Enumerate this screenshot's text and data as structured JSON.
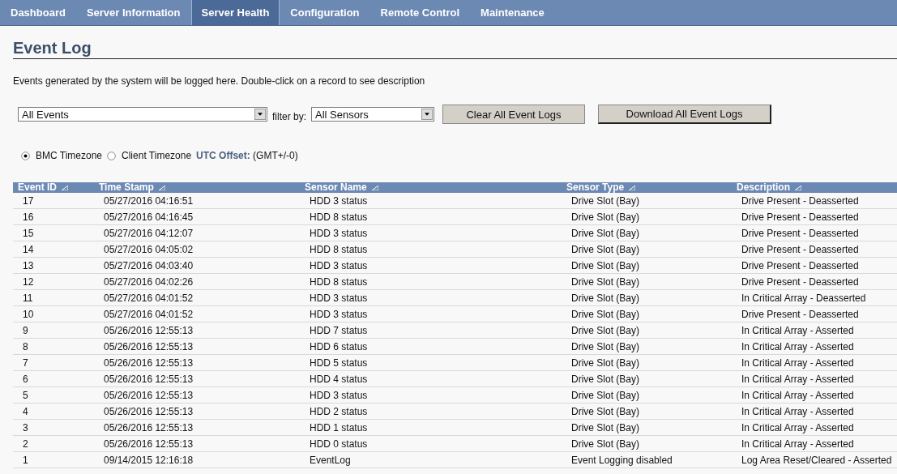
{
  "nav": [
    {
      "label": "Dashboard",
      "selected": false
    },
    {
      "label": "Server Information",
      "selected": false
    },
    {
      "label": "Server Health",
      "selected": true
    },
    {
      "label": "Configuration",
      "selected": false
    },
    {
      "label": "Remote Control",
      "selected": false
    },
    {
      "label": "Maintenance",
      "selected": false
    }
  ],
  "title": "Event Log",
  "description": "Events generated by the system will be logged here. Double-click on a record to see description",
  "event_filter": {
    "value": "All Events"
  },
  "filter_label": "filter by:",
  "sensor_filter": {
    "value": "All Sensors"
  },
  "buttons": [
    {
      "label": "Clear All Event Logs",
      "kind": "normal"
    },
    {
      "label": "Download All Event Logs",
      "kind": "default"
    }
  ],
  "timezones": [
    {
      "label": "BMC Timezone",
      "selected": true
    },
    {
      "label": "Client Timezone",
      "selected": false
    }
  ],
  "utc_offset": {
    "label": "UTC Offset:",
    "value": "(GMT+/-0)"
  },
  "table": {
    "columns": [
      "Event ID",
      "Time Stamp",
      "Sensor Name",
      "Sensor Type",
      "Description"
    ],
    "rows": [
      [
        "17",
        "05/27/2016 04:16:51",
        "HDD 3 status",
        "Drive Slot (Bay)",
        "Drive Present - Deasserted"
      ],
      [
        "16",
        "05/27/2016 04:16:45",
        "HDD 8 status",
        "Drive Slot (Bay)",
        "Drive Present - Deasserted"
      ],
      [
        "15",
        "05/27/2016 04:12:07",
        "HDD 3 status",
        "Drive Slot (Bay)",
        "Drive Present - Deasserted"
      ],
      [
        "14",
        "05/27/2016 04:05:02",
        "HDD 8 status",
        "Drive Slot (Bay)",
        "Drive Present - Deasserted"
      ],
      [
        "13",
        "05/27/2016 04:03:40",
        "HDD 3 status",
        "Drive Slot (Bay)",
        "Drive Present - Deasserted"
      ],
      [
        "12",
        "05/27/2016 04:02:26",
        "HDD 8 status",
        "Drive Slot (Bay)",
        "Drive Present - Deasserted"
      ],
      [
        "11",
        "05/27/2016 04:01:52",
        "HDD 3 status",
        "Drive Slot (Bay)",
        "In Critical Array - Deasserted"
      ],
      [
        "10",
        "05/27/2016 04:01:52",
        "HDD 3 status",
        "Drive Slot (Bay)",
        "Drive Present - Deasserted"
      ],
      [
        "9",
        "05/26/2016 12:55:13",
        "HDD 7 status",
        "Drive Slot (Bay)",
        "In Critical Array - Asserted"
      ],
      [
        "8",
        "05/26/2016 12:55:13",
        "HDD 6 status",
        "Drive Slot (Bay)",
        "In Critical Array - Asserted"
      ],
      [
        "7",
        "05/26/2016 12:55:13",
        "HDD 5 status",
        "Drive Slot (Bay)",
        "In Critical Array - Asserted"
      ],
      [
        "6",
        "05/26/2016 12:55:13",
        "HDD 4 status",
        "Drive Slot (Bay)",
        "In Critical Array - Asserted"
      ],
      [
        "5",
        "05/26/2016 12:55:13",
        "HDD 3 status",
        "Drive Slot (Bay)",
        "In Critical Array - Asserted"
      ],
      [
        "4",
        "05/26/2016 12:55:13",
        "HDD 2 status",
        "Drive Slot (Bay)",
        "In Critical Array - Asserted"
      ],
      [
        "3",
        "05/26/2016 12:55:13",
        "HDD 1 status",
        "Drive Slot (Bay)",
        "In Critical Array - Asserted"
      ],
      [
        "2",
        "05/26/2016 12:55:13",
        "HDD 0 status",
        "Drive Slot (Bay)",
        "In Critical Array - Asserted"
      ],
      [
        "1",
        "09/14/2015 12:16:18",
        "EventLog",
        "Event Logging disabled",
        "Log Area Reset/Cleared - Asserted"
      ]
    ]
  }
}
